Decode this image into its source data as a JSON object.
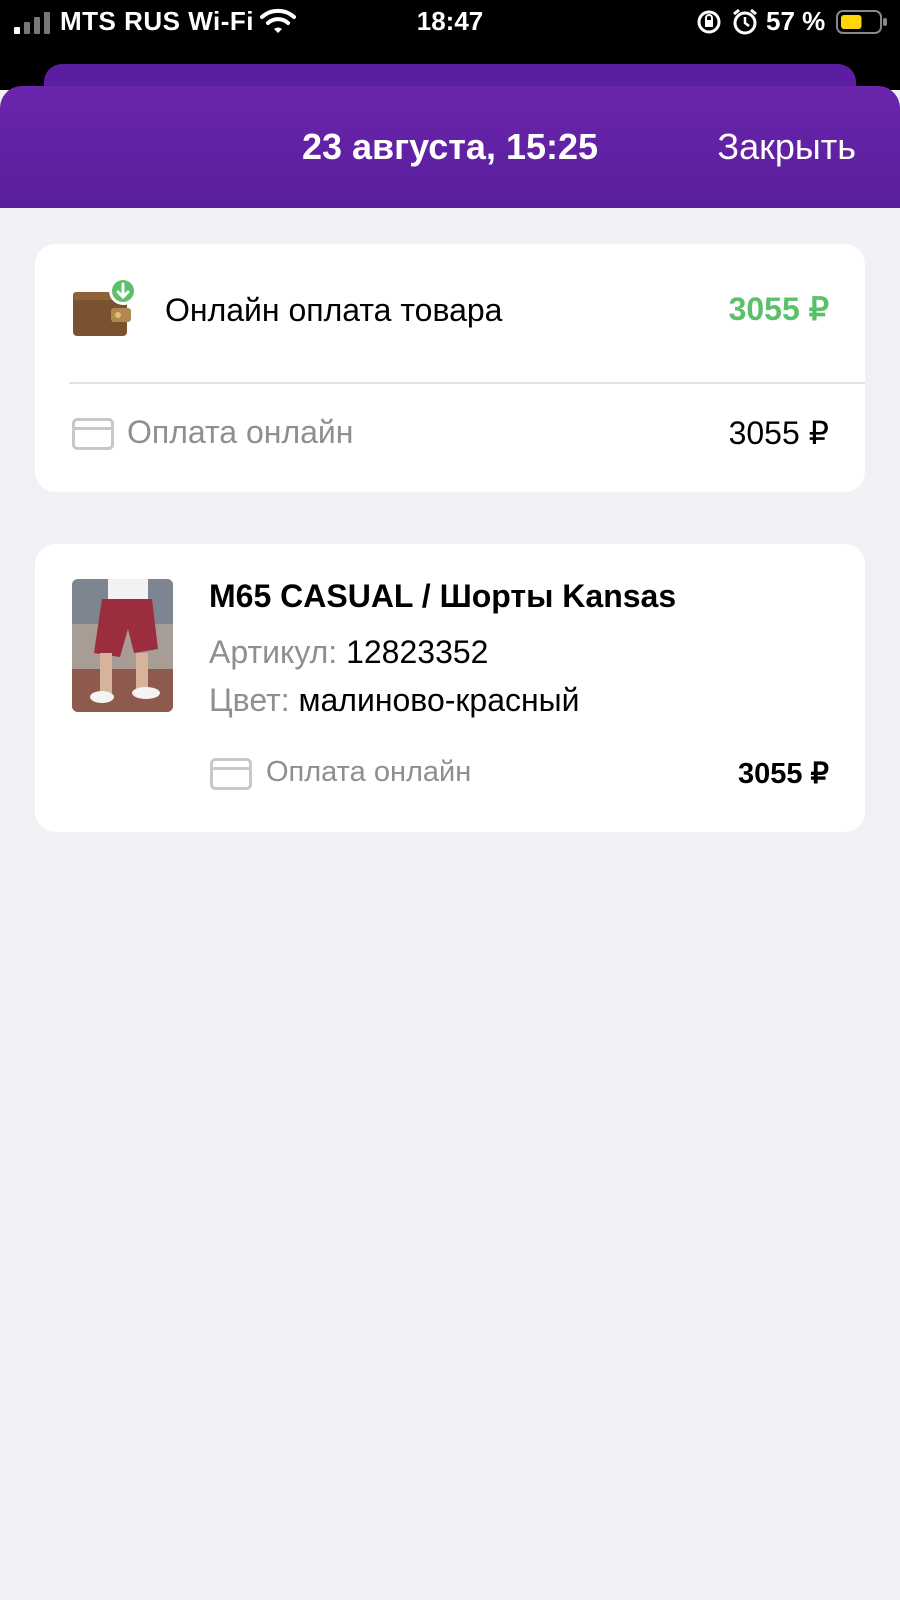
{
  "status_bar": {
    "carrier": "MTS RUS Wi-Fi",
    "time": "18:47",
    "battery_percent": "57 %",
    "battery_level": 0.57,
    "icons": [
      "signal-icon",
      "wifi-icon",
      "rotation-lock-icon",
      "alarm-icon",
      "battery-icon"
    ]
  },
  "header": {
    "title": "23 августа, 15:25",
    "close_label": "Закрыть"
  },
  "summary": {
    "title": "Онлайн оплата товара",
    "total": "3055 ₽",
    "total_color": "#5cbf6a",
    "payment_method": "Оплата онлайн",
    "payment_amount": "3055 ₽"
  },
  "item": {
    "title": "M65 CASUAL / Шорты Kansas",
    "article_label": "Артикул:",
    "article_value": "12823352",
    "color_label": "Цвет:",
    "color_value": "малиново-красный",
    "payment_method": "Оплата онлайн",
    "price": "3055 ₽"
  },
  "colors": {
    "accent": "#5a1e9c",
    "background": "#f0f0f5"
  }
}
